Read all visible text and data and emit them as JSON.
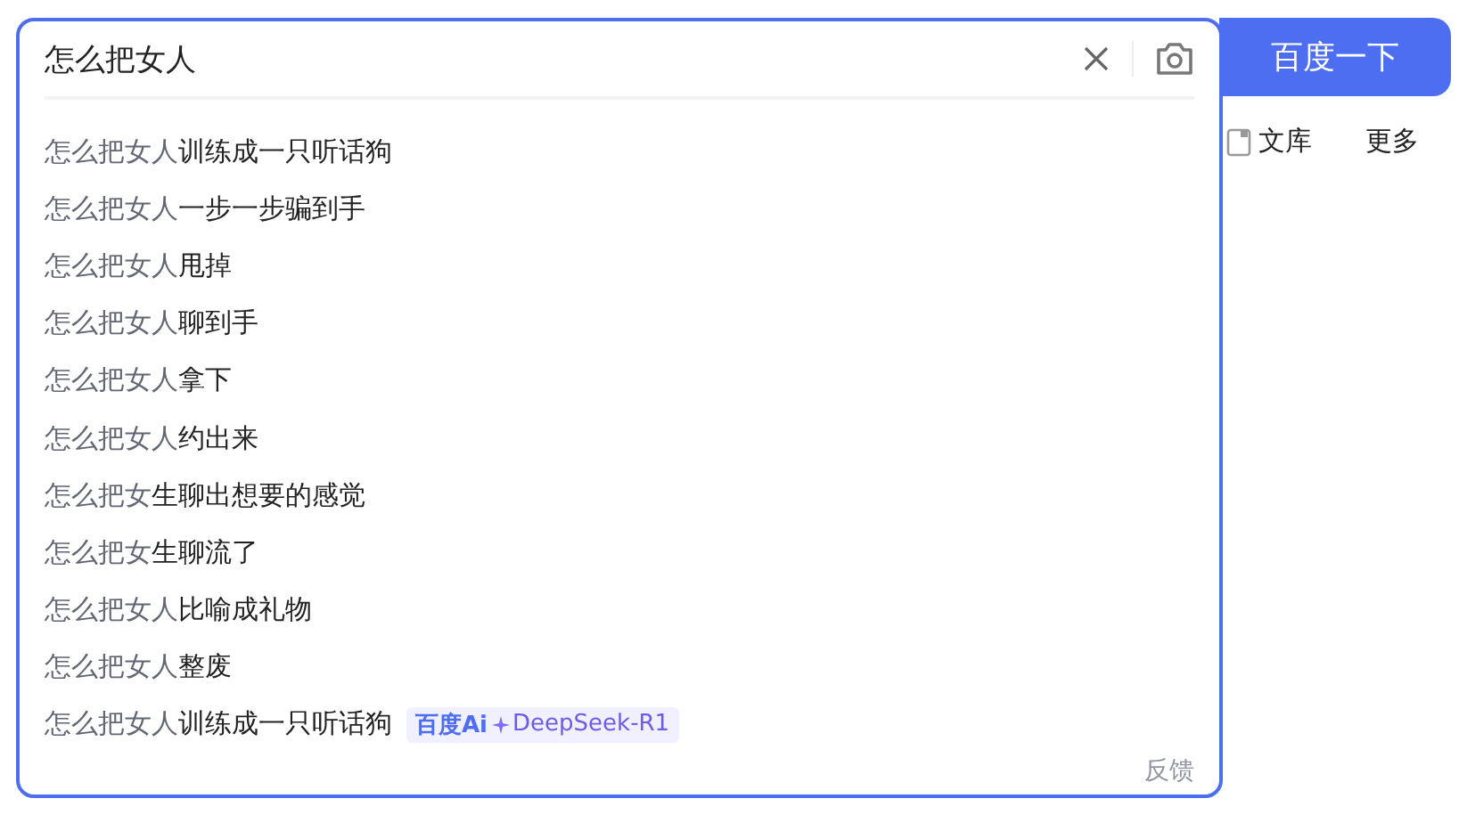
{
  "search": {
    "value": "怎么把女人",
    "button": "百度一下"
  },
  "nav": [
    {
      "label": "文库"
    },
    {
      "label": "更多"
    }
  ],
  "suggestions": [
    {
      "match": "怎么把女人",
      "rest": "训练成一只听话狗"
    },
    {
      "match": "怎么把女人",
      "rest": "一步一步骗到手"
    },
    {
      "match": "怎么把女人",
      "rest": "甩掉"
    },
    {
      "match": "怎么把女人",
      "rest": "聊到手"
    },
    {
      "match": "怎么把女人",
      "rest": "拿下"
    },
    {
      "match": "怎么把女人",
      "rest": "约出来"
    },
    {
      "match": "怎么把女",
      "rest": "生聊出想要的感觉"
    },
    {
      "match": "怎么把女",
      "rest": "生聊流了"
    },
    {
      "match": "怎么把女人",
      "rest": "比喻成礼物"
    },
    {
      "match": "怎么把女人",
      "rest": "整废"
    },
    {
      "match": "怎么把女人",
      "rest": "训练成一只听话狗",
      "badge": {
        "logo": "百度Ai",
        "model": "DeepSeek-R1"
      }
    }
  ],
  "feedback": "反馈"
}
